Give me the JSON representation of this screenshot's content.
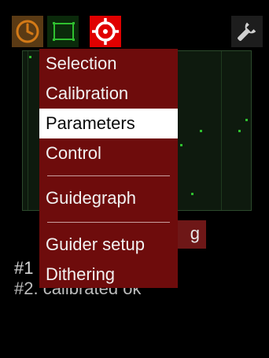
{
  "toolbar": {
    "clock_icon": "clock-icon",
    "frame_icon": "frame-icon",
    "target_icon": "crosshair-target-icon",
    "settings_icon": "wrench-icon",
    "colors": {
      "clock_bg": "#5a3a14",
      "clock_fg": "#d47a17",
      "frame_bg": "#0b2a0b",
      "frame_fg": "#2fbf2f",
      "target_bg": "#e00000",
      "target_fg": "#ffffff",
      "settings_fg": "#d0d0d0"
    }
  },
  "menu": {
    "items": [
      {
        "label": "Selection",
        "selected": false
      },
      {
        "label": "Calibration",
        "selected": false
      },
      {
        "label": "Parameters",
        "selected": true
      },
      {
        "label": "Control",
        "selected": false
      },
      {
        "label": "Guidegraph",
        "selected": false
      },
      {
        "label": "Guider setup",
        "selected": false
      },
      {
        "label": "Dithering",
        "selected": false
      }
    ],
    "colors": {
      "background": "#6e0c0c",
      "selected_background": "#ffffff"
    }
  },
  "background_button": {
    "label": "g"
  },
  "status": {
    "line1": "#1",
    "line2": "#2. calibrated ok"
  },
  "graph": {
    "point_color": "#2fbf2f"
  }
}
